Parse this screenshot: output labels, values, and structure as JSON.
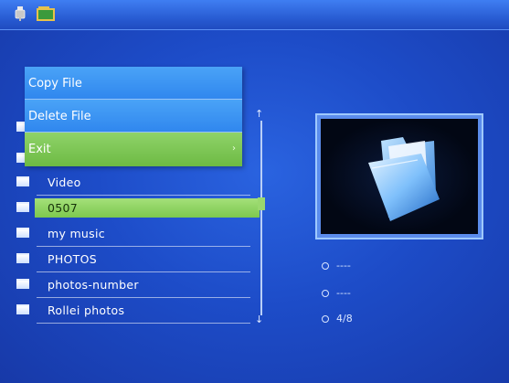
{
  "topbar": {
    "icons": [
      "usb-icon",
      "memory-card-icon"
    ]
  },
  "context_menu": {
    "items": [
      {
        "label": "Copy File",
        "state": "normal"
      },
      {
        "label": "Delete File",
        "state": "normal"
      },
      {
        "label": "Exit",
        "state": "highlighted"
      }
    ],
    "submenu_arrow": "›"
  },
  "file_list": {
    "items": [
      {
        "label": "",
        "selected": false
      },
      {
        "label": "",
        "selected": false
      },
      {
        "label": "Video",
        "selected": false
      },
      {
        "label": "0507",
        "selected": true
      },
      {
        "label": "my music",
        "selected": false
      },
      {
        "label": "PHOTOS",
        "selected": false
      },
      {
        "label": "photos-number",
        "selected": false
      },
      {
        "label": "Rollei photos",
        "selected": false
      }
    ]
  },
  "scrollbar": {
    "up_arrow": "↑",
    "down_arrow": "↓"
  },
  "preview": {
    "icon": "folder-icon"
  },
  "info": {
    "line1": "----",
    "line2": "----",
    "line3": "4/8"
  },
  "colors": {
    "background": "#1f4fc9",
    "menu_normal": "#3a92f3",
    "menu_active": "#7cc84e",
    "selection": "#8fd563"
  }
}
